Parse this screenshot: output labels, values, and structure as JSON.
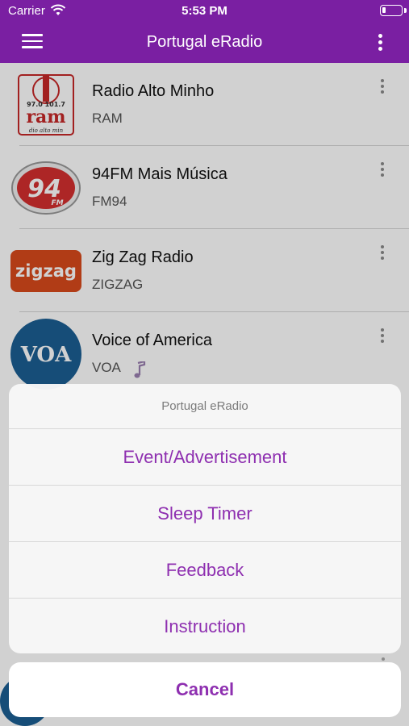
{
  "status_bar": {
    "carrier": "Carrier",
    "time": "5:53 PM"
  },
  "nav": {
    "title": "Portugal eRadio",
    "menu_icon": "hamburger-menu-icon",
    "more_icon": "vertical-dots-icon"
  },
  "stations": [
    {
      "name": "Radio Alto Minho",
      "code": "RAM",
      "logo": {
        "top": "97.0  101.7",
        "main": "ram",
        "bottom": "dio alto min"
      }
    },
    {
      "name": "94FM Mais Música",
      "code": "FM94",
      "logo": {
        "main": "94",
        "sub": "FM"
      }
    },
    {
      "name": "Zig Zag Radio",
      "code": "ZIGZAG",
      "logo": {
        "main": "zigzag"
      }
    },
    {
      "name": "Voice of America",
      "code": "VOA",
      "logo": {
        "main": "VOA"
      },
      "playing": true
    }
  ],
  "action_sheet": {
    "title": "Portugal eRadio",
    "options": [
      "Event/Advertisement",
      "Sleep Timer",
      "Feedback",
      "Instruction"
    ],
    "cancel": "Cancel"
  },
  "colors": {
    "brand": "#7a1fa2",
    "action_tint": "#8e2fb0"
  }
}
